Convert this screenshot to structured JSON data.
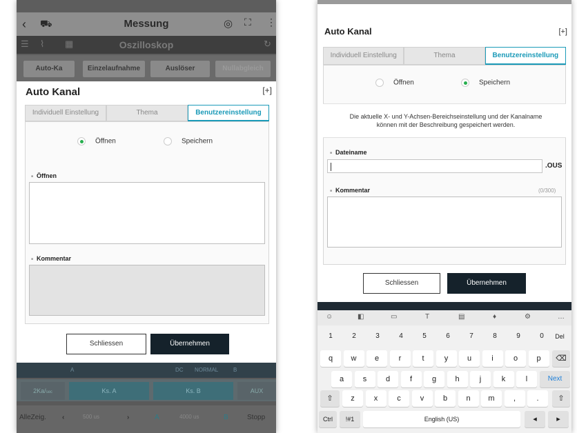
{
  "left": {
    "app_title": "Messung",
    "scope_title": "Oszilloskop",
    "mode_buttons": [
      "Auto-Ka",
      "Einzelaufnahme",
      "Auslöser",
      "Nullabgleich"
    ],
    "dialog": {
      "title": "Auto Kanal",
      "tabs": [
        "Individuell Einstellung",
        "Thema",
        "Benutzereinstellung"
      ],
      "radio_open": "Öffnen",
      "radio_save": "Speichern",
      "section_open": "Öffnen",
      "section_comment": "Kommentar"
    },
    "buttons": {
      "close": "Schliessen",
      "apply": "Übernehmen"
    },
    "strip": {
      "a": "A",
      "dc": "DC",
      "normal": "NORMAL",
      "b": "B"
    },
    "channel_row": {
      "ka": "2Ka/",
      "ka_unit": "sec",
      "ks_a": "Ks. A",
      "ks_b": "Ks. B",
      "aux": "AUX"
    },
    "bottom_row": {
      "allezeig": "AlleZeig.",
      "time1": "500 us",
      "a": "A",
      "time2": "4000 us",
      "b": "B",
      "stop": "Stopp"
    }
  },
  "right": {
    "dialog": {
      "title": "Auto Kanal",
      "tabs": [
        "Individuell Einstellung",
        "Thema",
        "Benutzereinstellung"
      ],
      "radio_open": "Öffnen",
      "radio_save": "Speichern",
      "description_line1": "Die aktuelle X- und Y-Achsen-Bereichseinstellung und der Kanalname",
      "description_line2": "können mit der Beschreibung gespeichert werden.",
      "filename_label": "Dateiname",
      "filename_value": "",
      "extension": ".OUS",
      "comment_label": "Kommentar",
      "comment_counter": "(0/300)"
    },
    "buttons": {
      "close": "Schliessen",
      "apply": "Übernehmen"
    },
    "keyboard": {
      "numbers": [
        "1",
        "2",
        "3",
        "4",
        "5",
        "6",
        "7",
        "8",
        "9",
        "0"
      ],
      "del": "Del",
      "row1": [
        "q",
        "w",
        "e",
        "r",
        "t",
        "y",
        "u",
        "i",
        "o",
        "p"
      ],
      "row2": [
        "a",
        "s",
        "d",
        "f",
        "g",
        "h",
        "j",
        "k",
        "l"
      ],
      "row3": [
        "z",
        "x",
        "c",
        "v",
        "b",
        "n",
        "m",
        ",",
        "."
      ],
      "next": "Next",
      "ctrl": "Ctrl",
      "sym": "!#1",
      "space": "English (US)"
    }
  },
  "colors": {
    "accent": "#1a9ab8",
    "radio_on": "#27ae4e",
    "primary_button": "#15222b",
    "next_key": "#1e7fd8"
  }
}
